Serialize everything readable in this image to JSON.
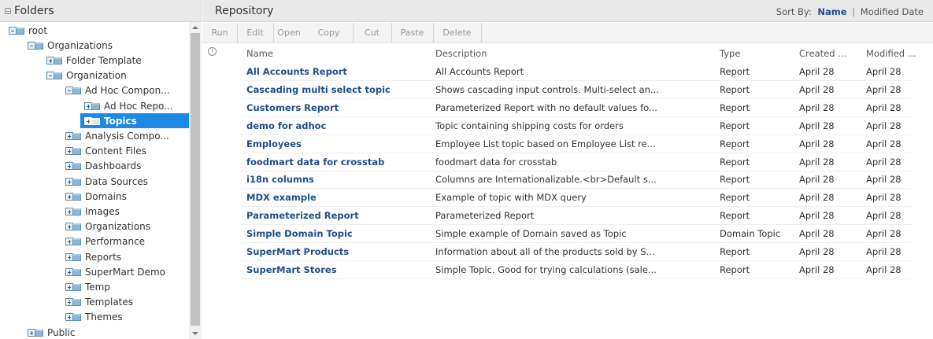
{
  "folders_panel": {
    "title": "Folders",
    "tree": [
      {
        "label": "root",
        "depth": 0,
        "expanded": true,
        "selected": false
      },
      {
        "label": "Organizations",
        "depth": 1,
        "expanded": true,
        "selected": false
      },
      {
        "label": "Folder Template",
        "depth": 2,
        "expanded": false,
        "selected": false
      },
      {
        "label": "Organization",
        "depth": 2,
        "expanded": true,
        "selected": false
      },
      {
        "label": "Ad Hoc Compon...",
        "depth": 3,
        "expanded": true,
        "selected": false
      },
      {
        "label": "Ad Hoc Repo...",
        "depth": 4,
        "expanded": false,
        "selected": false
      },
      {
        "label": "Topics",
        "depth": 4,
        "expanded": false,
        "selected": true
      },
      {
        "label": "Analysis Compo...",
        "depth": 3,
        "expanded": false,
        "selected": false
      },
      {
        "label": "Content Files",
        "depth": 3,
        "expanded": false,
        "selected": false
      },
      {
        "label": "Dashboards",
        "depth": 3,
        "expanded": false,
        "selected": false
      },
      {
        "label": "Data Sources",
        "depth": 3,
        "expanded": false,
        "selected": false
      },
      {
        "label": "Domains",
        "depth": 3,
        "expanded": false,
        "selected": false
      },
      {
        "label": "Images",
        "depth": 3,
        "expanded": false,
        "selected": false
      },
      {
        "label": "Organizations",
        "depth": 3,
        "expanded": false,
        "selected": false
      },
      {
        "label": "Performance",
        "depth": 3,
        "expanded": false,
        "selected": false
      },
      {
        "label": "Reports",
        "depth": 3,
        "expanded": false,
        "selected": false
      },
      {
        "label": "SuperMart Demo",
        "depth": 3,
        "expanded": false,
        "selected": false
      },
      {
        "label": "Temp",
        "depth": 3,
        "expanded": false,
        "selected": false
      },
      {
        "label": "Templates",
        "depth": 3,
        "expanded": false,
        "selected": false
      },
      {
        "label": "Themes",
        "depth": 3,
        "expanded": false,
        "selected": false
      },
      {
        "label": "Public",
        "depth": 1,
        "expanded": false,
        "selected": false
      }
    ]
  },
  "repository": {
    "title": "Repository",
    "sort": {
      "label": "Sort By:",
      "active": "Name",
      "separator": "|",
      "other": "Modified Date"
    },
    "toolbar": [
      "Run",
      "Edit",
      "Open",
      "Copy",
      "Cut",
      "Paste",
      "Delete"
    ],
    "columns": {
      "name": "Name",
      "description": "Description",
      "type": "Type",
      "created": "Created ...",
      "modified": "Modified ..."
    },
    "rows": [
      {
        "name": "All Accounts Report",
        "description": "All Accounts Report",
        "type": "Report",
        "created": "April 28",
        "modified": "April 28"
      },
      {
        "name": "Cascading multi select topic",
        "description": "Shows cascading input controls. Multi-select an...",
        "type": "Report",
        "created": "April 28",
        "modified": "April 28"
      },
      {
        "name": "Customers Report",
        "description": "Parameterized Report with no default values fo...",
        "type": "Report",
        "created": "April 28",
        "modified": "April 28"
      },
      {
        "name": "demo for adhoc",
        "description": "Topic containing shipping costs for orders",
        "type": "Report",
        "created": "April 28",
        "modified": "April 28"
      },
      {
        "name": "Employees",
        "description": "Employee List topic based on Employee List re...",
        "type": "Report",
        "created": "April 28",
        "modified": "April 28"
      },
      {
        "name": "foodmart data for crosstab",
        "description": "foodmart data for crosstab",
        "type": "Report",
        "created": "April 28",
        "modified": "April 28"
      },
      {
        "name": "i18n columns",
        "description": "Columns are Internationalizable.<br>Default s...",
        "type": "Report",
        "created": "April 28",
        "modified": "April 28"
      },
      {
        "name": "MDX example",
        "description": "Example of topic with MDX query",
        "type": "Report",
        "created": "April 28",
        "modified": "April 28"
      },
      {
        "name": "Parameterized Report",
        "description": "Parameterized Report",
        "type": "Report",
        "created": "April 28",
        "modified": "April 28"
      },
      {
        "name": "Simple Domain Topic",
        "description": "Simple example of Domain saved as Topic",
        "type": "Domain Topic",
        "created": "April 28",
        "modified": "April 28"
      },
      {
        "name": "SuperMart Products",
        "description": "Information about all of the products sold by S...",
        "type": "Report",
        "created": "April 28",
        "modified": "April 28"
      },
      {
        "name": "SuperMart Stores",
        "description": "Simple Topic. Good for trying calculations (sale...",
        "type": "Report",
        "created": "April 28",
        "modified": "April 28"
      }
    ]
  }
}
